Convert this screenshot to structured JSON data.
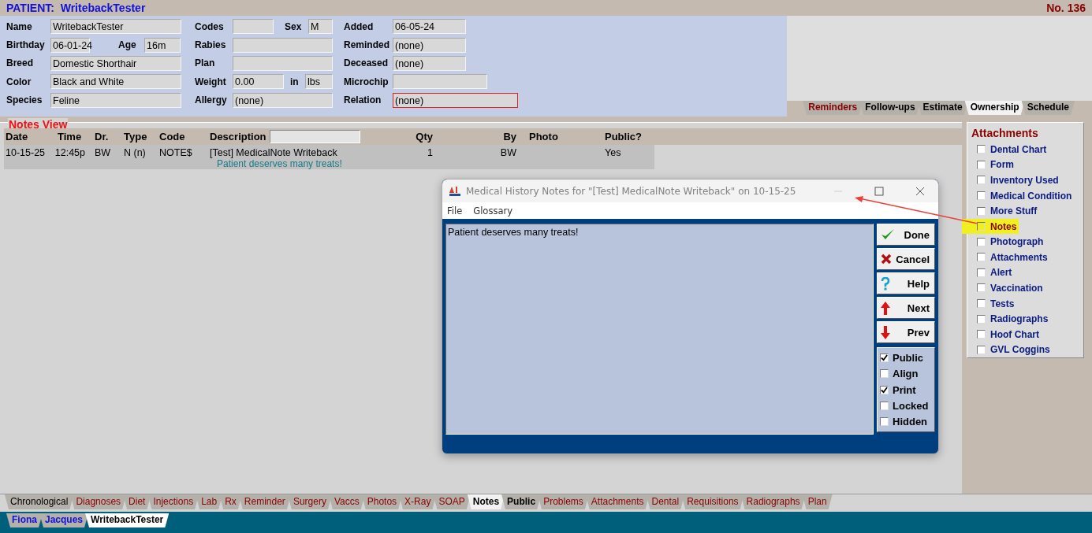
{
  "header": {
    "title": "PATIENT:  WritebackTester",
    "number": "No. 136"
  },
  "patient": {
    "groups": [
      [
        [
          {
            "label": "Name",
            "value": "WritebackTester",
            "flagged": false
          }
        ],
        [
          {
            "label": "Birthday",
            "value": "06-01-24",
            "flagged": false
          },
          {
            "label": "Age",
            "value": "16m",
            "flagged": false
          }
        ],
        [
          {
            "label": "Breed",
            "value": "Domestic Shorthair",
            "flagged": false
          }
        ],
        [
          {
            "label": "Color",
            "value": "Black and White",
            "flagged": false
          }
        ],
        [
          {
            "label": "Species",
            "value": "Feline",
            "flagged": false
          }
        ]
      ],
      [
        [
          {
            "label": "Codes",
            "flagged": false
          },
          {
            "label": "Sex",
            "value": "M",
            "flagged": false
          }
        ],
        [
          {
            "label": "Rabies",
            "flagged": false
          }
        ],
        [
          {
            "label": "Plan",
            "flagged": false
          }
        ],
        [
          {
            "label": "Weight",
            "value": "0.00",
            "flagged": false
          },
          {
            "label": "in",
            "value": "lbs",
            "flagged": false
          }
        ],
        [
          {
            "label": "Allergy",
            "value": "(none)",
            "flagged": false
          }
        ]
      ],
      [
        [
          {
            "label": "Added",
            "value": "06-05-24",
            "flagged": false
          }
        ],
        [
          {
            "label": "Reminded",
            "value": "(none)",
            "flagged": false
          }
        ],
        [
          {
            "label": "Deceased",
            "value": "(none)",
            "flagged": false
          }
        ],
        [
          {
            "label": "Microchip",
            "flagged": false
          }
        ],
        [
          {
            "label": "Relation",
            "value": "(none)",
            "flagged": true
          }
        ]
      ]
    ]
  },
  "side_tabs": [
    {
      "label": "Reminders",
      "has_entries": false,
      "selected": false
    },
    {
      "label": "Follow-ups",
      "has_entries": true,
      "selected": false
    },
    {
      "label": "Estimate",
      "has_entries": true,
      "selected": false
    },
    {
      "label": "Ownership",
      "has_entries": true,
      "selected": true
    },
    {
      "label": "Schedule",
      "has_entries": true,
      "selected": false
    }
  ],
  "notes_view": {
    "title": "Notes View",
    "columns": [
      "Date",
      "Time",
      "Dr.",
      "Type",
      "Code",
      "Description",
      "Qty",
      "By",
      "Photo",
      "Public?"
    ],
    "rows": [
      {
        "date": "10-15-25",
        "time": "12:45p",
        "dr": "BW",
        "type": "N (n)",
        "code": "NOTE$",
        "description": "[Test] MedicalNote Writeback",
        "qty": "1",
        "by": "BW",
        "public": "Yes",
        "note": "Patient deserves many treats!"
      }
    ]
  },
  "dialog": {
    "title": "Medical History Notes for \"[Test] MedicalNote Writeback\" on 10-15-25",
    "menu": [
      "File",
      "Glossary"
    ],
    "text": "Patient deserves many treats!",
    "buttons": [
      {
        "label": "Done",
        "kind": "done"
      },
      {
        "label": "Cancel",
        "kind": "cancel"
      },
      {
        "label": "Help",
        "kind": "help"
      },
      {
        "label": "Next",
        "kind": "next"
      },
      {
        "label": "Prev",
        "kind": "prev"
      }
    ],
    "options": [
      {
        "label": "Public",
        "checked": true
      },
      {
        "label": "Align",
        "checked": false
      },
      {
        "label": "Print",
        "checked": true
      },
      {
        "label": "Locked",
        "checked": false
      },
      {
        "label": "Hidden",
        "checked": false
      }
    ]
  },
  "attachments": {
    "title": "Attachments",
    "items": [
      {
        "label": "Dental Chart",
        "checked": false,
        "highlighted": false
      },
      {
        "label": "Form",
        "checked": false,
        "highlighted": false
      },
      {
        "label": "Inventory Used",
        "checked": false,
        "highlighted": false
      },
      {
        "label": "Medical Condition",
        "checked": false,
        "highlighted": false
      },
      {
        "label": "More Stuff",
        "checked": false,
        "highlighted": false
      },
      {
        "label": "Notes",
        "checked": false,
        "highlighted": true
      },
      {
        "label": "Photograph",
        "checked": false,
        "highlighted": false
      },
      {
        "label": "Attachments",
        "checked": false,
        "highlighted": false
      },
      {
        "label": "Alert",
        "checked": false,
        "highlighted": false
      },
      {
        "label": "Vaccination",
        "checked": false,
        "highlighted": false
      },
      {
        "label": "Tests",
        "checked": false,
        "highlighted": false
      },
      {
        "label": "Radiographs",
        "checked": false,
        "highlighted": false
      },
      {
        "label": "Hoof Chart",
        "checked": false,
        "highlighted": false
      },
      {
        "label": "GVL Coggins",
        "checked": false,
        "highlighted": false
      }
    ]
  },
  "record_tabs": [
    {
      "label": "Chronological",
      "has_entries": true,
      "bold": false,
      "selected": false
    },
    {
      "label": "Diagnoses",
      "has_entries": false,
      "bold": false,
      "selected": false
    },
    {
      "label": "Diet",
      "has_entries": false,
      "bold": false,
      "selected": false
    },
    {
      "label": "Injections",
      "has_entries": false,
      "bold": false,
      "selected": false
    },
    {
      "label": "Lab",
      "has_entries": false,
      "bold": false,
      "selected": false
    },
    {
      "label": "Rx",
      "has_entries": false,
      "bold": false,
      "selected": false
    },
    {
      "label": "Reminder",
      "has_entries": false,
      "bold": false,
      "selected": false
    },
    {
      "label": "Surgery",
      "has_entries": false,
      "bold": false,
      "selected": false
    },
    {
      "label": "Vaccs",
      "has_entries": false,
      "bold": false,
      "selected": false
    },
    {
      "label": "Photos",
      "has_entries": false,
      "bold": false,
      "selected": false
    },
    {
      "label": "X-Ray",
      "has_entries": false,
      "bold": false,
      "selected": false
    },
    {
      "label": "SOAP",
      "has_entries": false,
      "bold": false,
      "selected": false
    },
    {
      "label": "Notes",
      "has_entries": true,
      "bold": true,
      "selected": true
    },
    {
      "label": "Public",
      "has_entries": true,
      "bold": true,
      "selected": false
    },
    {
      "label": "Problems",
      "has_entries": false,
      "bold": false,
      "selected": false
    },
    {
      "label": "Attachments",
      "has_entries": false,
      "bold": false,
      "selected": false
    },
    {
      "label": "Dental",
      "has_entries": false,
      "bold": false,
      "selected": false
    },
    {
      "label": "Requisitions",
      "has_entries": false,
      "bold": false,
      "selected": false
    },
    {
      "label": "Radiographs",
      "has_entries": false,
      "bold": false,
      "selected": false
    },
    {
      "label": "Plan",
      "has_entries": false,
      "bold": false,
      "selected": false
    }
  ],
  "patient_tabs": [
    {
      "label": "Fiona",
      "selected": false
    },
    {
      "label": "Jacques",
      "selected": false
    },
    {
      "label": "WritebackTester",
      "selected": true
    }
  ]
}
